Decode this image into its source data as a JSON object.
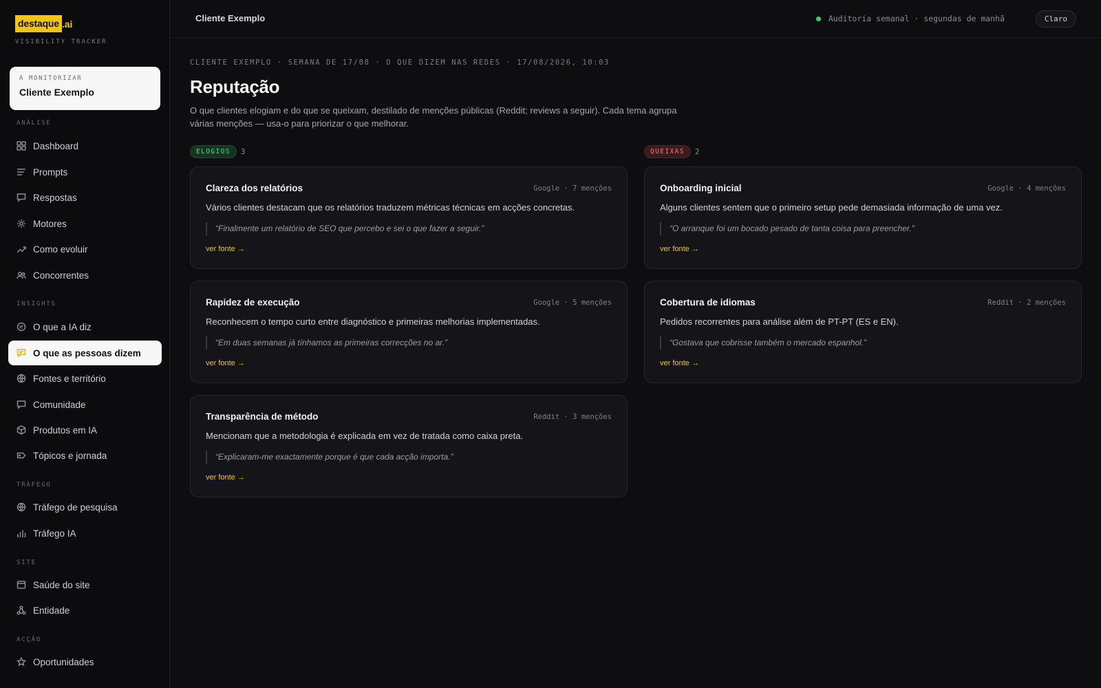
{
  "brand": {
    "mark": "destaque",
    "tld": ".ai",
    "subtitle": "VISIBILITY TRACKER"
  },
  "client_card": {
    "label": "A MONITORIZAR",
    "name": "Cliente Exemplo"
  },
  "nav": {
    "analise": {
      "title": "ANÁLISE",
      "items": [
        {
          "label": "Dashboard",
          "icon": "grid-icon"
        },
        {
          "label": "Prompts",
          "icon": "lines-icon"
        },
        {
          "label": "Respostas",
          "icon": "chat-icon"
        },
        {
          "label": "Motores",
          "icon": "gear-icon"
        },
        {
          "label": "Como evoluir",
          "icon": "trend-icon"
        },
        {
          "label": "Concorrentes",
          "icon": "users-icon"
        }
      ]
    },
    "insights": {
      "title": "INSIGHTS",
      "items": [
        {
          "label": "O que a IA diz",
          "icon": "ai-icon"
        },
        {
          "label": "O que as pessoas dizem",
          "icon": "speech-icon"
        },
        {
          "label": "Fontes e território",
          "icon": "globe-icon"
        },
        {
          "label": "Comunidade",
          "icon": "chat-icon"
        },
        {
          "label": "Produtos em IA",
          "icon": "box-icon"
        },
        {
          "label": "Tópicos e jornada",
          "icon": "tag-icon"
        }
      ]
    },
    "trafego": {
      "title": "TRÁFEGO",
      "items": [
        {
          "label": "Tráfego de pesquisa",
          "icon": "globe-icon"
        },
        {
          "label": "Tráfego IA",
          "icon": "bars-icon"
        }
      ]
    },
    "site": {
      "title": "SITE",
      "items": [
        {
          "label": "Saúde do site",
          "icon": "browser-icon"
        },
        {
          "label": "Entidade",
          "icon": "graph-icon"
        }
      ]
    },
    "accao": {
      "title": "ACÇÃO",
      "items": [
        {
          "label": "Oportunidades",
          "icon": "star-icon"
        }
      ]
    }
  },
  "topbar": {
    "client": "Cliente Exemplo",
    "audit": "Auditoria semanal · segundas de manhã",
    "theme_button": "Claro",
    "status_color": "#34d26c"
  },
  "page": {
    "breadcrumb": "CLIENTE EXEMPLO · SEMANA DE 17/08 · O QUE DIZEM NAS REDES · 17/08/2026, 10:03",
    "title": "Reputação",
    "description": "O que clientes elogiam e do que se queixam, destilado de menções públicas (Reddit; reviews a seguir). Cada tema agrupa várias menções — usa-o para priorizar o que melhorar."
  },
  "praise": {
    "label": "ELOGIOS",
    "count": "3",
    "cards": [
      {
        "title": "Clareza dos relatórios",
        "meta": "Google · 7 menções",
        "body": "Vários clientes destacam que os relatórios traduzem métricas técnicas em acções concretas.",
        "quote": "“Finalmente um relatório de SEO que percebo e sei o que fazer a seguir.”",
        "link": "ver fonte →"
      },
      {
        "title": "Rapidez de execução",
        "meta": "Google · 5 menções",
        "body": "Reconhecem o tempo curto entre diagnóstico e primeiras melhorias implementadas.",
        "quote": "“Em duas semanas já tínhamos as primeiras correcções no ar.”",
        "link": "ver fonte →"
      },
      {
        "title": "Transparência de método",
        "meta": "Reddit · 3 menções",
        "body": "Mencionam que a metodologia é explicada em vez de tratada como caixa preta.",
        "quote": "“Explicaram-me exactamente porque é que cada acção importa.”",
        "link": "ver fonte →"
      }
    ]
  },
  "complaints": {
    "label": "QUEIXAS",
    "count": "2",
    "cards": [
      {
        "title": "Onboarding inicial",
        "meta": "Google · 4 menções",
        "body": "Alguns clientes sentem que o primeiro setup pede demasiada informação de uma vez.",
        "quote": "“O arranque foi um bocado pesado de tanta coisa para preencher.”",
        "link": "ver fonte →"
      },
      {
        "title": "Cobertura de idiomas",
        "meta": "Reddit · 2 menções",
        "body": "Pedidos recorrentes para análise além de PT-PT (ES e EN).",
        "quote": "“Gostava que cobrisse também o mercado espanhol.”",
        "link": "ver fonte →"
      }
    ]
  },
  "colors": {
    "accent": "#f2c418",
    "praise": "#5fd98a",
    "complaint": "#f07a7a"
  }
}
